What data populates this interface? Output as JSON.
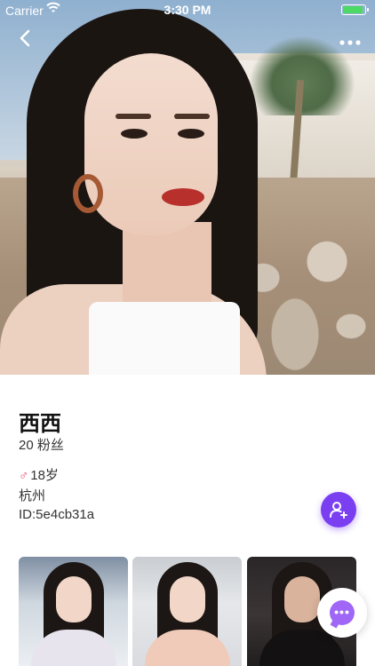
{
  "status_bar": {
    "carrier": "Carrier",
    "time": "3:30 PM",
    "battery_level": 0.9
  },
  "profile": {
    "name": "西西",
    "followers": "20 粉丝",
    "gender_symbol": "♂",
    "age": "18岁",
    "city": "杭州",
    "user_id": "ID:5e4cb31a"
  },
  "colors": {
    "accent": "#7b3ff2",
    "chat_accent": "#a066f5",
    "gender": "#e54b6a",
    "battery": "#4cd964"
  },
  "icons": {
    "back": "chevron-left-icon",
    "more": "more-horizontal-icon",
    "follow": "add-user-icon",
    "chat": "chat-bubble-icon",
    "wifi": "wifi-icon",
    "battery": "battery-icon"
  },
  "gallery": {
    "photo_count": 3
  }
}
